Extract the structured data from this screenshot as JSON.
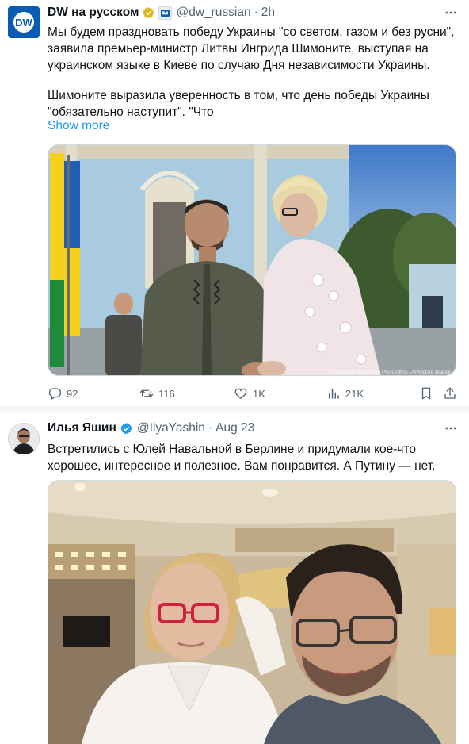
{
  "colors": {
    "link": "#1d9bf0",
    "muted": "#536471",
    "text": "#0f1419",
    "verified_gold": "#e2b719",
    "verified_blue": "#1d9bf0"
  },
  "tweet1": {
    "avatar_text": "DW",
    "name": "DW на русском",
    "badge": "gold-verified-badge",
    "handle": "@dw_russian",
    "sep": "·",
    "time": "2h",
    "text_p1": "Мы будем праздновать победу Украины \"со светом, газом и без русни\", заявила премьер-министр Литвы Ингрида Шимоните, выступая на украинском языке в Киеве по случаю Дня независимости Украины.",
    "text_p2": "Шимоните выразила уверенность в том, что день победы Украины \"обязательно наступит\". \"Что",
    "show_more": "Show more",
    "photo_credit": "© Ukrainian Presidential Press Office / AP/picture alliance",
    "actions": {
      "reply": "92",
      "retweet": "116",
      "like": "1K",
      "views": "21K"
    }
  },
  "tweet2": {
    "name": "Илья Яшин",
    "badge": "blue-verified-badge",
    "handle": "@IlyaYashin",
    "sep": "·",
    "time": "Aug 23",
    "text": "Встретились с Юлей Навальной в Берлине и придумали кое-что хорошее, интересное и полезное. Вам понравится. А Путину — нет."
  }
}
